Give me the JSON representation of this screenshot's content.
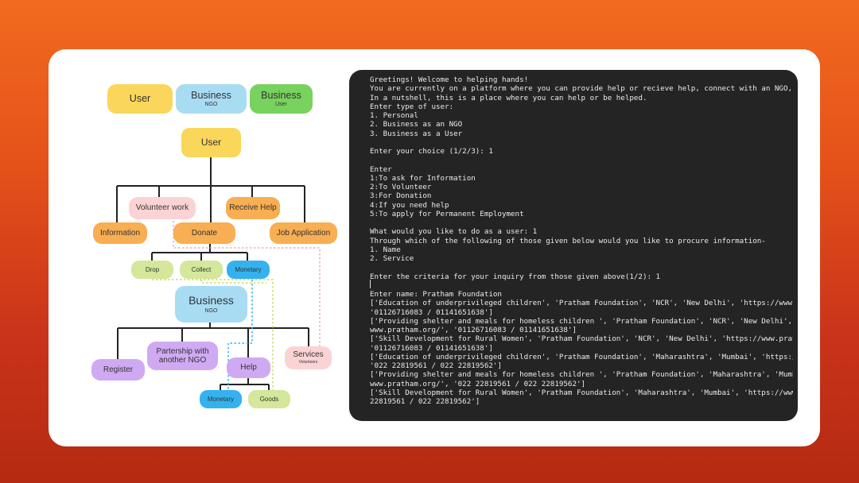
{
  "legend": {
    "user": {
      "title": "User"
    },
    "business_ngo": {
      "title": "Business",
      "sub": "NGO"
    },
    "business_user": {
      "title": "Business",
      "sub": "User"
    }
  },
  "diagram": {
    "user_root": "User",
    "volunteer_work": "Volunteer work",
    "receive_help": "Receive Help",
    "information": "Information",
    "donate": "Donate",
    "job_application": "Job Application",
    "drop": "Drop",
    "collect": "Collect",
    "monetary": "Monetary",
    "business": {
      "title": "Business",
      "sub": "NGO"
    },
    "register": "Register",
    "partnership": "Partership with another NGO",
    "help": "Help",
    "services": {
      "title": "Services",
      "sub": "Volunteers"
    },
    "help_monetary": "Monetary",
    "goods": "Goods"
  },
  "colors": {
    "yellow": "#fad75a",
    "blue": "#a8dcf3",
    "green": "#78d25e",
    "orange": "#f8ae52",
    "pink": "#fbd3d5",
    "lime": "#d4e79a",
    "bright_blue": "#35b2ee",
    "purple": "#cfaaf2",
    "terminal_bg": "#242424"
  },
  "terminal": {
    "lines": [
      "Greetings! Welcome to helping hands!",
      "You are currently on a platform where you can provide help or recieve help, connect with an NGO, prof",
      "In a nutshell, this is a place where you can help or be helped.",
      "Enter type of user:",
      "1. Personal",
      "2. Business as an NGO",
      "3. Business as a User",
      "",
      "Enter your choice (1/2/3): 1",
      "",
      "Enter",
      "1:To ask for Information",
      "2:To Volunteer",
      "3:For Donation",
      "4:If you need help",
      "5:To apply for Permanent Employment",
      "",
      "What would you like to do as a user: 1",
      "Through which of the following of those given below would you like to procure information-",
      "1. Name",
      "2. Service",
      "",
      "Enter the criteria for your inquiry from those given above(1/2): 1",
      "",
      "Enter name: Pratham Foundation",
      "['Education of underprivileged children', 'Pratham Foundation', 'NCR', 'New Delhi', 'https://www.prat",
      "'01126716083 / 01141651638']",
      "['Providing shelter and meals for homeless children ', 'Pratham Foundation', 'NCR', 'New Delhi', 'htt",
      "www.pratham.org/', '01126716083 / 01141651638']",
      "['Skill Development for Rural Women', 'Pratham Foundation', 'NCR', 'New Delhi', 'https://www.pratham.",
      "'01126716083 / 01141651638']",
      "['Education of underprivileged children', 'Pratham Foundation', 'Maharashtra', 'Mumbai', 'https://www",
      "'022 22819561 / 022 22819562']",
      "['Providing shelter and meals for homeless children ', 'Pratham Foundation', 'Maharashtra', 'Mumbai',",
      "www.pratham.org/', '022 22819561 / 022 22819562']",
      "['Skill Development for Rural Women', 'Pratham Foundation', 'Maharashtra', 'Mumbai', 'https://www.pra",
      "22819561 / 022 22819562']"
    ]
  }
}
